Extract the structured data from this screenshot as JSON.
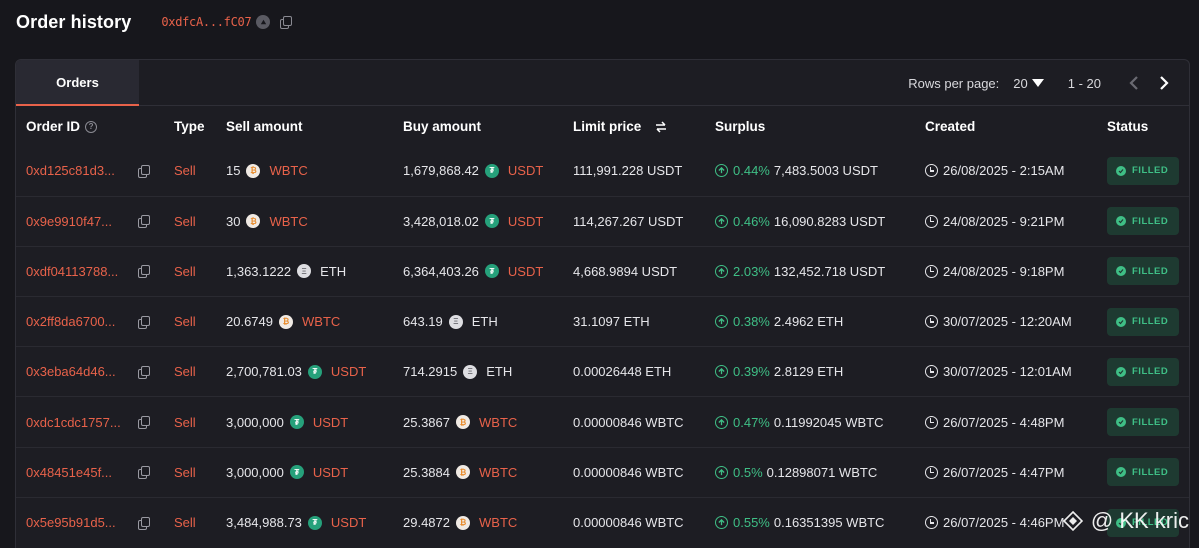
{
  "page": {
    "title": "Order history",
    "address": "0xdfcA...fC07"
  },
  "panel": {
    "tab_label": "Orders",
    "rows_per_page_label": "Rows per page:",
    "rows_per_page_value": "20",
    "range_label": "1 - 20"
  },
  "table": {
    "headers": {
      "order_id": "Order ID",
      "type": "Type",
      "sell_amount": "Sell amount",
      "buy_amount": "Buy amount",
      "limit_price": "Limit price",
      "surplus": "Surplus",
      "created": "Created",
      "status": "Status"
    },
    "rows": [
      {
        "order_id": "0xd125c81d3...",
        "type": "Sell",
        "sell_amt": "15",
        "sell_sym": "WBTC",
        "buy_amt": "1,679,868.42",
        "buy_sym": "USDT",
        "limit_price": "111,991.228 USDT",
        "surplus_pct": "0.44%",
        "surplus_val": "7,483.5003 USDT",
        "created": "26/08/2025 - 2:15AM",
        "status": "FILLED"
      },
      {
        "order_id": "0x9e9910f47...",
        "type": "Sell",
        "sell_amt": "30",
        "sell_sym": "WBTC",
        "buy_amt": "3,428,018.02",
        "buy_sym": "USDT",
        "limit_price": "114,267.267 USDT",
        "surplus_pct": "0.46%",
        "surplus_val": "16,090.8283 USDT",
        "created": "24/08/2025 - 9:21PM",
        "status": "FILLED"
      },
      {
        "order_id": "0xdf04113788...",
        "type": "Sell",
        "sell_amt": "1,363.1222",
        "sell_sym": "ETH",
        "buy_amt": "6,364,403.26",
        "buy_sym": "USDT",
        "limit_price": "4,668.9894 USDT",
        "surplus_pct": "2.03%",
        "surplus_val": "132,452.718 USDT",
        "created": "24/08/2025 - 9:18PM",
        "status": "FILLED"
      },
      {
        "order_id": "0x2ff8da6700...",
        "type": "Sell",
        "sell_amt": "20.6749",
        "sell_sym": "WBTC",
        "buy_amt": "643.19",
        "buy_sym": "ETH",
        "limit_price": "31.1097 ETH",
        "surplus_pct": "0.38%",
        "surplus_val": "2.4962 ETH",
        "created": "30/07/2025 - 12:20AM",
        "status": "FILLED"
      },
      {
        "order_id": "0x3eba64d46...",
        "type": "Sell",
        "sell_amt": "2,700,781.03",
        "sell_sym": "USDT",
        "buy_amt": "714.2915",
        "buy_sym": "ETH",
        "limit_price": "0.00026448 ETH",
        "surplus_pct": "0.39%",
        "surplus_val": "2.8129 ETH",
        "created": "30/07/2025 - 12:01AM",
        "status": "FILLED"
      },
      {
        "order_id": "0xdc1cdc1757...",
        "type": "Sell",
        "sell_amt": "3,000,000",
        "sell_sym": "USDT",
        "buy_amt": "25.3867",
        "buy_sym": "WBTC",
        "limit_price": "0.00000846 WBTC",
        "surplus_pct": "0.47%",
        "surplus_val": "0.11992045 WBTC",
        "created": "26/07/2025 - 4:48PM",
        "status": "FILLED"
      },
      {
        "order_id": "0x48451e45f...",
        "type": "Sell",
        "sell_amt": "3,000,000",
        "sell_sym": "USDT",
        "buy_amt": "25.3884",
        "buy_sym": "WBTC",
        "limit_price": "0.00000846 WBTC",
        "surplus_pct": "0.5%",
        "surplus_val": "0.12898071 WBTC",
        "created": "26/07/2025 - 4:47PM",
        "status": "FILLED"
      },
      {
        "order_id": "0x5e95b91d5...",
        "type": "Sell",
        "sell_amt": "3,484,988.73",
        "sell_sym": "USDT",
        "buy_amt": "29.4872",
        "buy_sym": "WBTC",
        "limit_price": "0.00000846 WBTC",
        "surplus_pct": "0.55%",
        "surplus_val": "0.16351395 WBTC",
        "created": "26/07/2025 - 4:46PM",
        "status": "FILLED"
      }
    ]
  },
  "watermark": {
    "text": "@ KK kric"
  },
  "colors": {
    "accent": "#e8624a",
    "success": "#3fbf86",
    "background": "#17171c",
    "panel": "#1d1d23"
  }
}
